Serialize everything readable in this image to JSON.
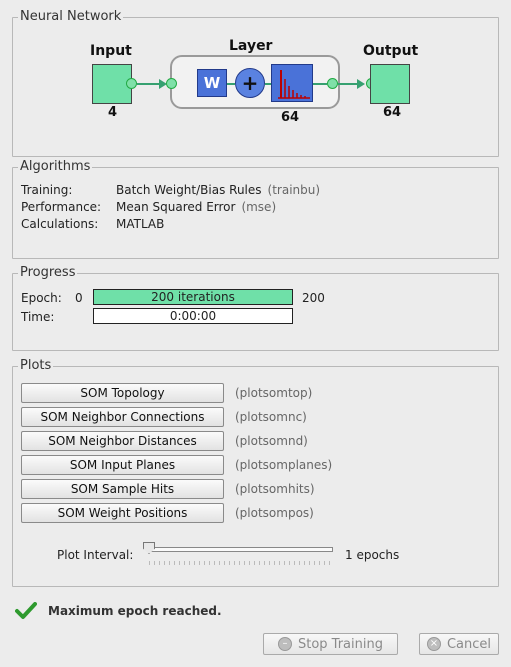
{
  "nn": {
    "title": "Neural Network",
    "input_label": "Input",
    "input_size": "4",
    "layer_label": "Layer",
    "layer_size": "64",
    "weight_symbol": "W",
    "plus_symbol": "+",
    "output_label": "Output",
    "output_size": "64"
  },
  "algorithms": {
    "title": "Algorithms",
    "rows": [
      {
        "label": "Training:",
        "value": "Batch Weight/Bias Rules",
        "fn": "(trainbu)"
      },
      {
        "label": "Performance:",
        "value": "Mean Squared Error",
        "fn": "(mse)"
      },
      {
        "label": "Calculations:",
        "value": "MATLAB",
        "fn": ""
      }
    ]
  },
  "progress": {
    "title": "Progress",
    "epoch_label": "Epoch:",
    "epoch_min": "0",
    "epoch_text": "200 iterations",
    "epoch_max": "200",
    "epoch_fraction": 1.0,
    "time_label": "Time:",
    "time_text": "0:00:00"
  },
  "plots": {
    "title": "Plots",
    "buttons": [
      {
        "label": "SOM Topology",
        "fn": "(plotsomtop)"
      },
      {
        "label": "SOM Neighbor Connections",
        "fn": "(plotsomnc)"
      },
      {
        "label": "SOM Neighbor Distances",
        "fn": "(plotsomnd)"
      },
      {
        "label": "SOM Input Planes",
        "fn": "(plotsomplanes)"
      },
      {
        "label": "SOM Sample Hits",
        "fn": "(plotsomhits)"
      },
      {
        "label": "SOM Weight Positions",
        "fn": "(plotsompos)"
      }
    ],
    "interval_label": "Plot Interval:",
    "interval_value": "1 epochs",
    "interval_fraction": 0.0
  },
  "status": {
    "message": "Maximum epoch reached.",
    "icon": "check-icon"
  },
  "footer": {
    "stop_label": "Stop Training",
    "cancel_label": "Cancel"
  },
  "colors": {
    "green_fill": "#6fe0a8",
    "blue_block": "#4a72d8",
    "check_green": "#2e9a2e"
  }
}
